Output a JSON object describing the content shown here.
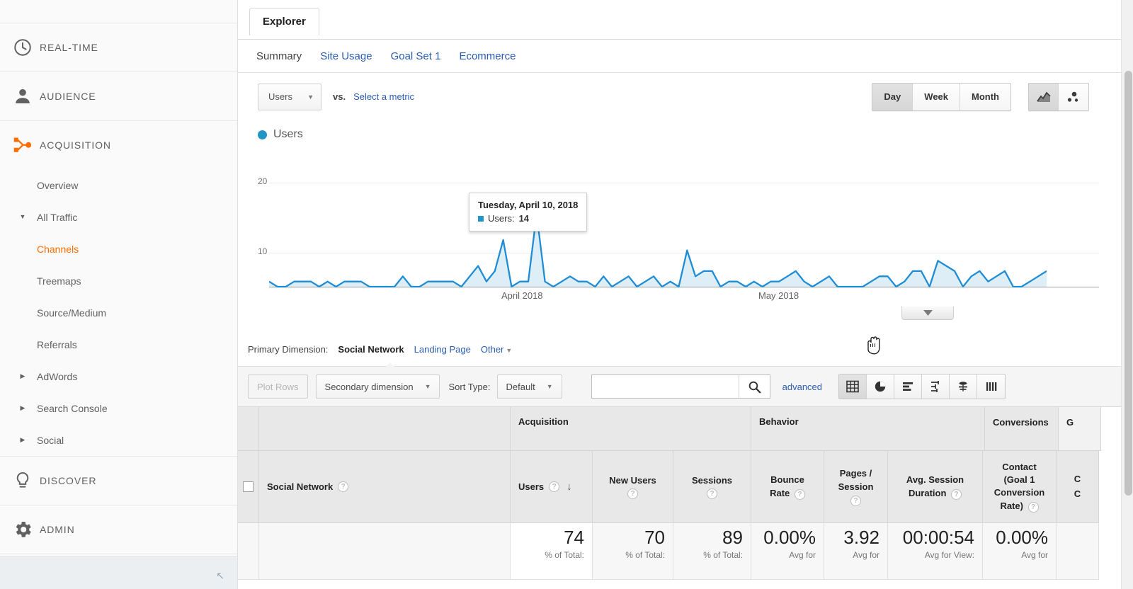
{
  "sidebar": {
    "main_items": [
      {
        "label": "REAL-TIME",
        "icon": "clock-icon"
      },
      {
        "label": "AUDIENCE",
        "icon": "person-icon"
      },
      {
        "label": "ACQUISITION",
        "icon": "acquisition-icon"
      }
    ],
    "acquisition_sub": [
      {
        "label": "Overview",
        "expandable": false,
        "active": false
      },
      {
        "label": "All Traffic",
        "expandable": true,
        "expanded": true,
        "active": false
      },
      {
        "label": "Channels",
        "expandable": false,
        "active": true,
        "indent": true
      },
      {
        "label": "Treemaps",
        "expandable": false,
        "active": false,
        "indent": true
      },
      {
        "label": "Source/Medium",
        "expandable": false,
        "active": false,
        "indent": true
      },
      {
        "label": "Referrals",
        "expandable": false,
        "active": false,
        "indent": true
      },
      {
        "label": "AdWords",
        "expandable": true,
        "expanded": false,
        "active": false
      },
      {
        "label": "Search Console",
        "expandable": true,
        "expanded": false,
        "active": false
      },
      {
        "label": "Social",
        "expandable": true,
        "expanded": false,
        "active": false
      }
    ],
    "bottom_items": [
      {
        "label": "DISCOVER",
        "icon": "lightbulb-icon"
      },
      {
        "label": "ADMIN",
        "icon": "gear-icon"
      }
    ],
    "active_color": "#ff6d00"
  },
  "report": {
    "tab_label": "Explorer",
    "subtabs": [
      {
        "label": "Summary",
        "active": true
      },
      {
        "label": "Site Usage",
        "active": false
      },
      {
        "label": "Goal Set 1",
        "active": false
      },
      {
        "label": "Ecommerce",
        "active": false
      }
    ],
    "metric_primary": "Users",
    "vs_label": "vs.",
    "metric_secondary_placeholder": "Select a metric",
    "granularity": [
      {
        "label": "Day",
        "active": true
      },
      {
        "label": "Week",
        "active": false
      },
      {
        "label": "Month",
        "active": false
      }
    ],
    "chart_type_icons": [
      {
        "name": "line-chart-icon",
        "active": true
      },
      {
        "name": "motion-chart-icon",
        "active": false
      }
    ]
  },
  "chart_data": {
    "type": "area",
    "title": "",
    "legend": [
      {
        "label": "Users",
        "color": "#2196c4"
      }
    ],
    "legend_position": "top-left",
    "xlabel": "",
    "ylabel": "",
    "ylim": [
      0,
      22
    ],
    "yticks": [
      10,
      20
    ],
    "ytick_labels": [
      "10",
      "20"
    ],
    "grid": true,
    "xtick_labels": [
      "April 2018",
      "May 2018"
    ],
    "line_color": "#1f8dd6",
    "fill_color": "#ddeef7",
    "series": [
      {
        "name": "Users",
        "values": [
          1,
          0,
          0,
          1,
          1,
          1,
          0,
          1,
          0,
          1,
          1,
          1,
          0,
          0,
          0,
          0,
          2,
          0,
          0,
          1,
          1,
          1,
          1,
          0,
          2,
          4,
          1,
          3,
          9,
          0,
          1,
          1,
          14,
          1,
          0,
          1,
          2,
          1,
          1,
          0,
          2,
          0,
          1,
          2,
          0,
          1,
          2,
          0,
          1,
          0,
          7,
          2,
          3,
          3,
          0,
          1,
          1,
          0,
          1,
          0,
          1,
          1,
          2,
          3,
          1,
          0,
          1,
          2,
          0,
          0,
          0,
          0,
          1,
          2,
          2,
          0,
          1,
          3,
          3,
          0,
          5,
          4,
          3,
          0,
          2,
          3,
          1,
          2,
          3,
          0,
          0,
          1,
          2,
          3
        ]
      }
    ],
    "tooltip": {
      "date": "Tuesday, April 10, 2018",
      "metric": "Users",
      "value": "14"
    }
  },
  "primary_dimension": {
    "label": "Primary Dimension:",
    "selected": "Social Network",
    "options": [
      "Landing Page"
    ],
    "other_label": "Other"
  },
  "toolbar": {
    "plot_rows": "Plot Rows",
    "secondary_dimension": "Secondary dimension",
    "sort_type_label": "Sort Type:",
    "sort_type_value": "Default",
    "search_value": "",
    "search_placeholder": "",
    "advanced": "advanced",
    "view_icons": [
      {
        "name": "table-view-icon",
        "active": true
      },
      {
        "name": "pie-view-icon",
        "active": false
      },
      {
        "name": "bar-view-icon",
        "active": false
      },
      {
        "name": "comparison-view-icon",
        "active": false
      },
      {
        "name": "pivot-view-icon",
        "active": false
      },
      {
        "name": "performance-view-icon",
        "active": false
      }
    ]
  },
  "table": {
    "group_headers": [
      {
        "label": "Acquisition"
      },
      {
        "label": "Behavior"
      },
      {
        "label": "Conversions"
      },
      {
        "label": "G"
      }
    ],
    "dimension_header": "Social Network",
    "columns": [
      {
        "label": "Users",
        "sorted": true,
        "sort_dir": "desc"
      },
      {
        "label": "New Users"
      },
      {
        "label": "Sessions"
      },
      {
        "label": "Bounce Rate"
      },
      {
        "label": "Pages / Session"
      },
      {
        "label": "Avg. Session Duration"
      },
      {
        "label": "Contact (Goal 1 Conversion Rate)"
      },
      {
        "label": "C"
      }
    ],
    "summary_row": [
      {
        "value": "74",
        "sub": "% of Total:"
      },
      {
        "value": "70",
        "sub": "% of Total:"
      },
      {
        "value": "89",
        "sub": "% of Total:"
      },
      {
        "value": "0.00%",
        "sub": "Avg for"
      },
      {
        "value": "3.92",
        "sub": "Avg for"
      },
      {
        "value": "00:00:54",
        "sub": "Avg for View:"
      },
      {
        "value": "0.00%",
        "sub": "Avg for"
      }
    ]
  }
}
